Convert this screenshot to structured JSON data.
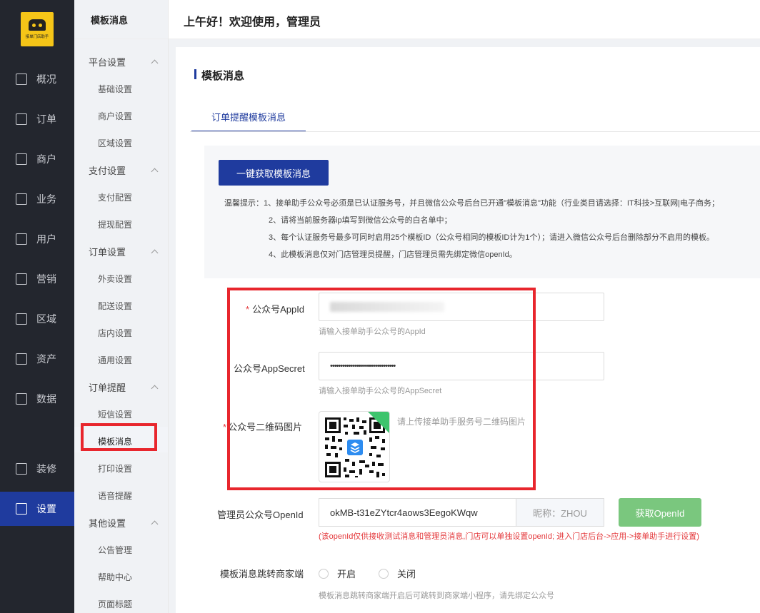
{
  "logo_text": "接单门店助手",
  "main_nav": [
    {
      "label": "概况",
      "icon": "monitor-icon"
    },
    {
      "label": "订单",
      "icon": "document-icon"
    },
    {
      "label": "商户",
      "icon": "store-icon"
    },
    {
      "label": "业务",
      "icon": "briefcase-icon"
    },
    {
      "label": "用户",
      "icon": "user-icon"
    },
    {
      "label": "营销",
      "icon": "bag-icon"
    },
    {
      "label": "区域",
      "icon": "database-icon"
    },
    {
      "label": "资产",
      "icon": "wallet-icon"
    },
    {
      "label": "数据",
      "icon": "bar-chart-icon"
    },
    {
      "label": "装修",
      "icon": "decor-icon"
    },
    {
      "label": "设置",
      "icon": "phone-settings-icon"
    }
  ],
  "active_main": "设置",
  "sub_nav": {
    "title": "模板消息",
    "groups": [
      {
        "label": "平台设置",
        "items": [
          "基础设置",
          "商户设置",
          "区域设置"
        ]
      },
      {
        "label": "支付设置",
        "items": [
          "支付配置",
          "提现配置"
        ]
      },
      {
        "label": "订单设置",
        "items": [
          "外卖设置",
          "配送设置",
          "店内设置",
          "通用设置"
        ]
      },
      {
        "label": "订单提醒",
        "items": [
          "短信设置",
          "模板消息",
          "打印设置",
          "语音提醒"
        ]
      },
      {
        "label": "其他设置",
        "items": [
          "公告管理",
          "帮助中心",
          "页面标题"
        ]
      }
    ],
    "active_item": "模板消息"
  },
  "header": {
    "greeting": "上午好！欢迎使用，管理员"
  },
  "page": {
    "title": "模板消息",
    "tab": "订单提醒模板消息",
    "fetch_button": "一键获取模板消息",
    "tips": [
      "温馨提示：1、接单助手公众号必须是已认证服务号，并且微信公众号后台已开通\"模板消息\"功能（行业类目请选择：IT科技>互联网|电子商务；",
      "2、请将当前服务器ip填写到微信公众号的白名单中；",
      "3、每个认证服务号最多可同时启用25个模板ID（公众号相同的模板ID计为1个）；请进入微信公众号后台删除部分不启用的模板。",
      "4、此模板消息仅对门店管理员提醒，门店管理员需先绑定微信openId。"
    ],
    "form": {
      "appid_label": "公众号AppId",
      "appid_help": "请输入接单助手公众号的AppId",
      "secret_label": "公众号AppSecret",
      "secret_value": "••••••••••••••••••••••••••••••••",
      "secret_help": "请输入接单助手公众号的AppSecret",
      "qr_label": "公众号二维码图片",
      "qr_help": "请上传接单助手服务号二维码图片",
      "openid_label": "管理员公众号OpenId",
      "openid_value": "okMB-t31eZYtcr4aows3EegoKWqw",
      "nickname": "昵称：ZHOU",
      "openid_button": "获取OpenId",
      "openid_warning": "(该openId仅供接收测试消息和管理员消息,门店可以单独设置openId; 进入门店后台->应用->接单助手进行设置)",
      "jump_label": "模板消息跳转商家端",
      "jump_options": [
        "开启",
        "关闭"
      ],
      "jump_help": "模板消息跳转商家端开启后可跳转到商家端小程序，请先绑定公众号"
    }
  },
  "colors": {
    "primary": "#1f3b9e",
    "sidebar": "#23262e",
    "highlight": "#e8262d",
    "success": "#7ac77e"
  }
}
